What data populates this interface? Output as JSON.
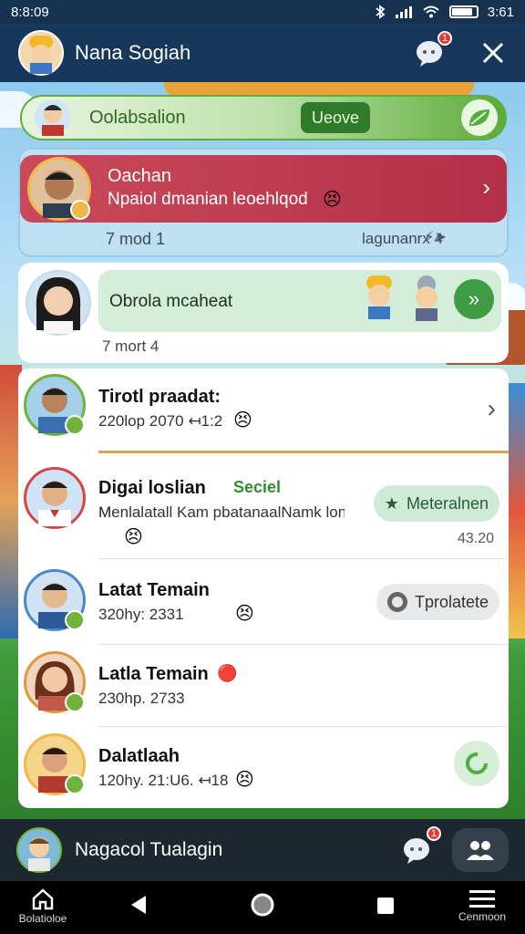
{
  "status": {
    "time": "8:8:09",
    "right_text": "3:61"
  },
  "header": {
    "title": "Nana Sogiah",
    "notif_count": "1"
  },
  "filter": {
    "label": "Oolabsalion",
    "chip": "Ueove"
  },
  "featured": {
    "name": "Oachan",
    "message": "Npaiol dmanian leoehlqod",
    "meta_left": "7 mod 1",
    "meta_right": "lagunanrx 4"
  },
  "card2": {
    "message": "Obrola mcaheat",
    "time": "7 mort 4"
  },
  "list": [
    {
      "name": "Tirotl praadat:",
      "sub": "220lop 2070 ↤1:2"
    },
    {
      "name": "Digai loslian",
      "tag": "Seciel",
      "sub": "Menlalatall Kam pbatanaalNamk lon",
      "action": "Meteralnen",
      "time": "43.20"
    },
    {
      "name": "Latat Temain",
      "sub": "320hy: 2331",
      "action": "Tprolatete"
    },
    {
      "name": "Latla Temain",
      "sub": "230hp. 2733"
    },
    {
      "name": "Dalatlaah",
      "sub": "120hy. 21:U6. ↤18"
    }
  ],
  "bottom": {
    "label": "Nagacol Tualagin",
    "notif_count": "1"
  },
  "nav": {
    "home_caption": "Bolatioloe",
    "menu_caption": "Cenmoon"
  },
  "colors": {
    "header_bg": "#17385a",
    "accent_green": "#3f9c44",
    "featured_red": "#c94a5a"
  }
}
